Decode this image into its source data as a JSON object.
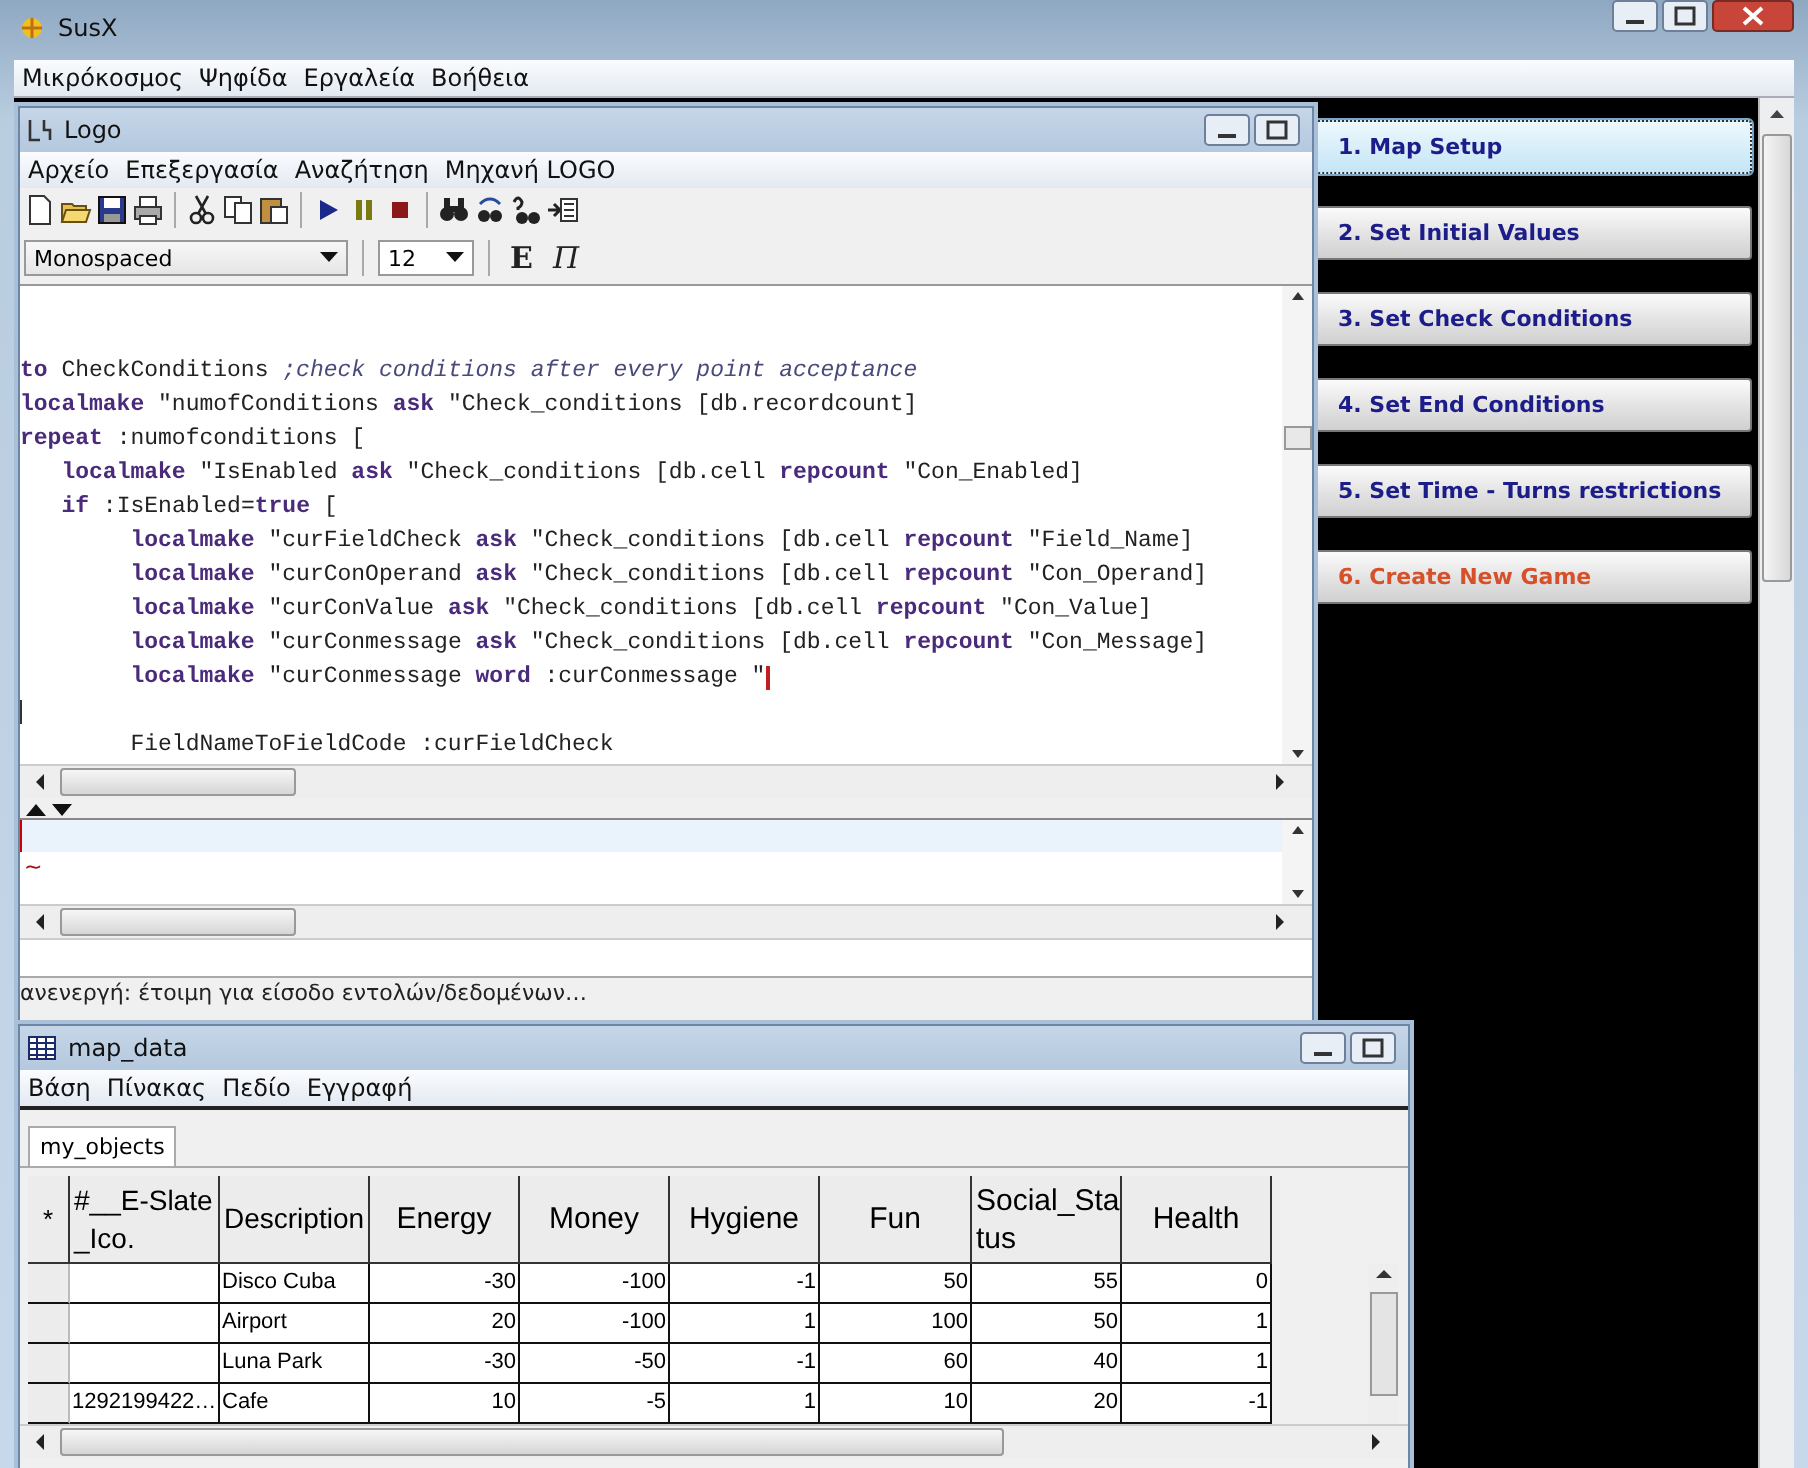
{
  "window": {
    "title": "SusX"
  },
  "menu": [
    "Μικρόκοσμος",
    "Ψηφίδα",
    "Εργαλεία",
    "Βοήθεια"
  ],
  "logo_window": {
    "title": "Logo",
    "menu": [
      "Αρχείο",
      "Επεξεργασία",
      "Αναζήτηση",
      "Μηχανή LOGO"
    ],
    "font": "Monospaced",
    "font_size": "12",
    "bold_button": "E",
    "italic_button": "Π",
    "code_lines": [
      {
        "kind": "code",
        "cursor": false,
        "text": "**to** CheckConditions *;check conditions after every point acceptance*"
      },
      {
        "kind": "code",
        "cursor": false,
        "text": "**localmake** \"numofConditions **ask** \"Check_conditions [db.recordcount]"
      },
      {
        "kind": "code",
        "cursor": false,
        "text": "**repeat** :numofconditions ["
      },
      {
        "kind": "code",
        "cursor": false,
        "text": "   **localmake** \"IsEnabled **ask** \"Check_conditions [db.cell **repcount** \"Con_Enabled]"
      },
      {
        "kind": "code",
        "cursor": false,
        "text": "   **if** :IsEnabled=**true** ["
      },
      {
        "kind": "code",
        "cursor": false,
        "text": "        **localmake** \"curFieldCheck **ask** \"Check_conditions [db.cell **repcount** \"Field_Name]"
      },
      {
        "kind": "code",
        "cursor": false,
        "text": "        **localmake** \"curConOperand **ask** \"Check_conditions [db.cell **repcount** \"Con_Operand]"
      },
      {
        "kind": "code",
        "cursor": false,
        "text": "        **localmake** \"curConValue **ask** \"Check_conditions [db.cell **repcount** \"Con_Value]"
      },
      {
        "kind": "code",
        "cursor": false,
        "text": "        **localmake** \"curConmessage **ask** \"Check_conditions [db.cell **repcount** \"Con_Message]"
      },
      {
        "kind": "code",
        "cursor": true,
        "text": "        **localmake** \"curConmessage **word** :curConmessage \""
      },
      {
        "kind": "caret"
      },
      {
        "kind": "code",
        "cursor": false,
        "text": "        FieldNameToFieldCode :curFieldCheck"
      }
    ],
    "command_marker": "~",
    "status": "ανενεργή: έτοιμη για είσοδο εντολών/δεδομένων…"
  },
  "steps": [
    {
      "label": "1. Map Setup",
      "selected": true,
      "color": "#1c1c8a"
    },
    {
      "label": "2. Set Initial Values",
      "selected": false,
      "color": "#1c1c8a"
    },
    {
      "label": "3. Set Check Conditions",
      "selected": false,
      "color": "#1c1c8a"
    },
    {
      "label": "4. Set End Conditions",
      "selected": false,
      "color": "#1c1c8a"
    },
    {
      "label": "5. Set Time - Turns restrictions",
      "selected": false,
      "color": "#1c1c8a"
    },
    {
      "label": "6. Create New Game",
      "selected": false,
      "color": "#d6502a"
    }
  ],
  "map_window": {
    "title": "map_data",
    "menu": [
      "Βάση",
      "Πίνακας",
      "Πεδίο",
      "Εγγραφή"
    ],
    "tabs": [
      {
        "label": "my_objects",
        "selected": true
      }
    ],
    "table": {
      "corner": "*",
      "columns": [
        "#__E-Slate_Ico.",
        "Description",
        "Energy",
        "Money",
        "Hygiene",
        "Fun",
        "Social_Status",
        "Health"
      ],
      "rows": [
        [
          null,
          "Disco Cuba",
          "-30",
          "-100",
          "-1",
          "50",
          "55",
          "0"
        ],
        [
          null,
          "Airport",
          "20",
          "-100",
          "1",
          "100",
          "50",
          "1"
        ],
        [
          null,
          "Luna Park",
          "-30",
          "-50",
          "-1",
          "60",
          "40",
          "1"
        ],
        [
          "1292199422…",
          "Cafe",
          "10",
          "-5",
          "1",
          "10",
          "20",
          "-1"
        ]
      ]
    }
  }
}
